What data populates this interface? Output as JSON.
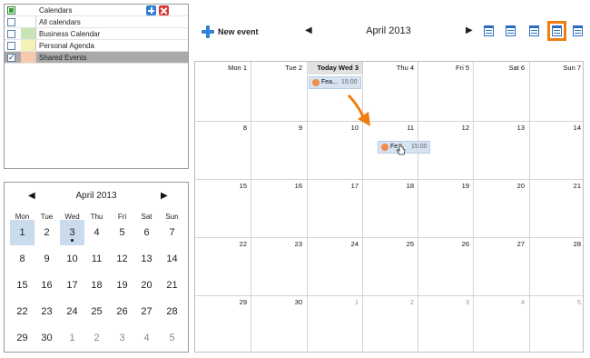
{
  "calendar_list": {
    "header": "Calendars",
    "items": [
      {
        "label": "All calendars",
        "color": "",
        "checked": false,
        "selected": false
      },
      {
        "label": "Business Calendar",
        "color": "#c9e4b4",
        "checked": false,
        "selected": false
      },
      {
        "label": "Personal Agenda",
        "color": "#f4f1b5",
        "checked": false,
        "selected": false
      },
      {
        "label": "Shared Events",
        "color": "#f6c9ad",
        "checked": true,
        "selected": true
      }
    ],
    "add_icon": "plus-icon",
    "delete_icon": "close-icon"
  },
  "mini_calendar": {
    "title": "April 2013",
    "prev": "◀",
    "next": "▶",
    "weekdays": [
      "Mon",
      "Tue",
      "Wed",
      "Thu",
      "Fri",
      "Sat",
      "Sun"
    ],
    "days": [
      "1",
      "2",
      "3",
      "4",
      "5",
      "6",
      "7",
      "8",
      "9",
      "10",
      "11",
      "12",
      "13",
      "14",
      "15",
      "16",
      "17",
      "18",
      "19",
      "20",
      "21",
      "22",
      "23",
      "24",
      "25",
      "26",
      "27",
      "28",
      "29",
      "30",
      "1",
      "2",
      "3",
      "4",
      "5"
    ],
    "selected_days": [
      "1",
      "3"
    ],
    "event_dot_day": "3"
  },
  "toolbar": {
    "new_event": "New event",
    "prev": "◀",
    "next": "▶",
    "title": "April 2013",
    "views": [
      "week-view-icon",
      "workweek-view-icon",
      "multiweek-view-icon",
      "month-view-icon",
      "year-view-icon"
    ],
    "active_view": "month-view-icon",
    "highlight_color": "#ef7d0f"
  },
  "month": {
    "weekday_headers": [
      "Mon 1",
      "Tue 2",
      "Today  Wed 3",
      "Thu 4",
      "Fri 5",
      "Sat 6",
      "Sun 7"
    ],
    "rows": [
      [
        "8",
        "9",
        "10",
        "11",
        "12",
        "13",
        "14"
      ],
      [
        "15",
        "16",
        "17",
        "18",
        "19",
        "20",
        "21"
      ],
      [
        "22",
        "23",
        "24",
        "25",
        "26",
        "27",
        "28"
      ],
      [
        "29",
        "30",
        "1",
        "2",
        "3",
        "4",
        "5"
      ]
    ],
    "events": [
      {
        "title": "Fea...",
        "time": "15:00",
        "day": "3"
      },
      {
        "title": "Fe",
        "time": "15:00",
        "day": "11",
        "dragging": true
      }
    ]
  },
  "colors": {
    "accent": "#2f82d4",
    "event_bg": "#d6e3f1",
    "event_dot": "#f08d4c",
    "selection": "#c9dbec",
    "arrow": "#ef7d0f"
  }
}
